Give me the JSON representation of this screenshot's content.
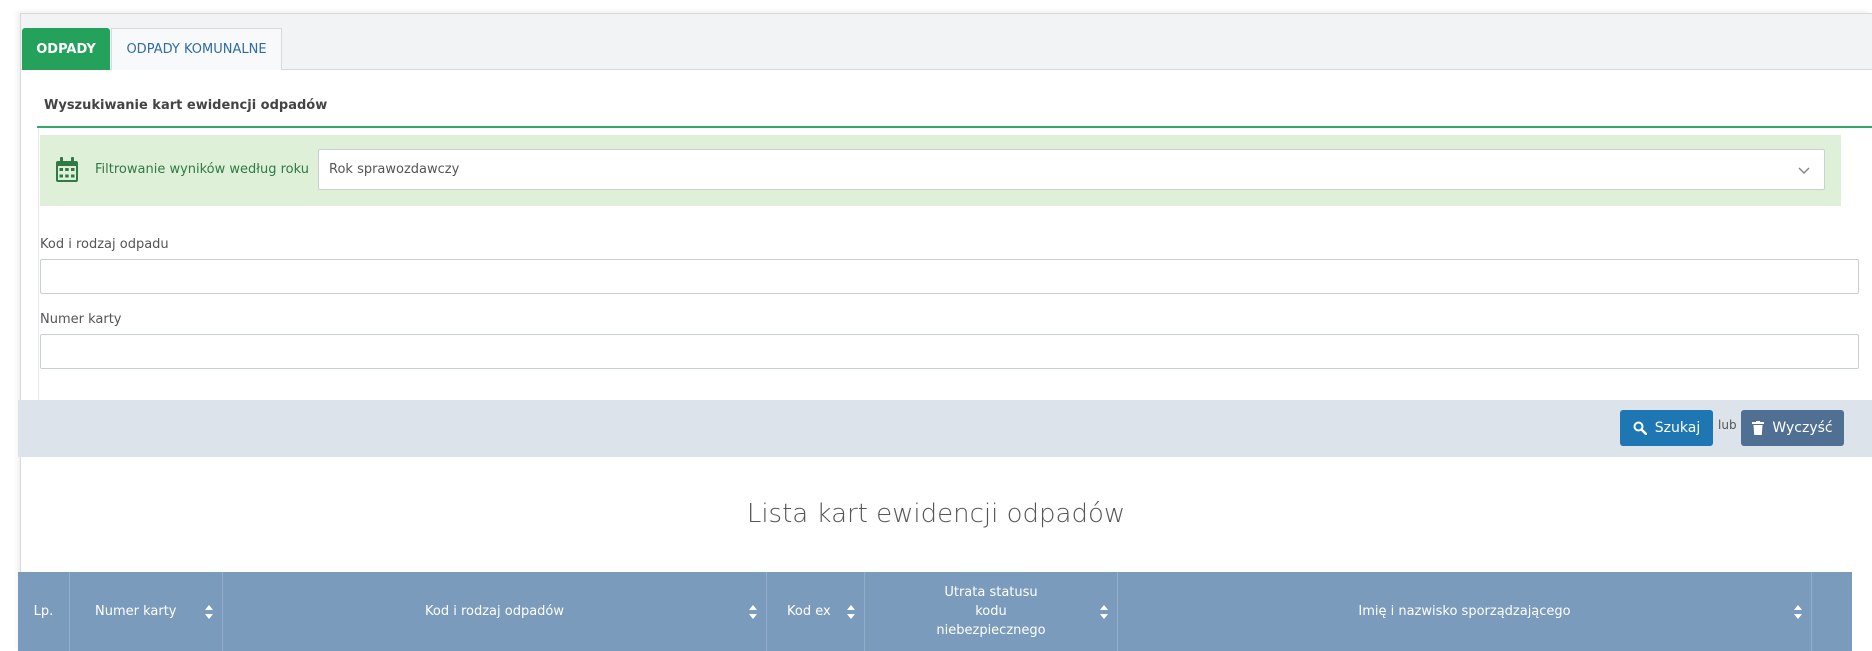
{
  "tabs": [
    {
      "label": "ODPADY",
      "active": true
    },
    {
      "label": "ODPADY KOMUNALNE",
      "active": false
    }
  ],
  "search_section": {
    "title": "Wyszukiwanie kart ewidencji odpadów",
    "year_filter": {
      "icon": "calendar-icon",
      "label": "Filtrowanie wyników według roku",
      "select_placeholder": "Rok sprawozdawczy"
    },
    "waste_code_label": "Kod i rodzaj odpadu",
    "waste_code_value": "",
    "card_number_label": "Numer karty",
    "card_number_value": ""
  },
  "actions": {
    "search_label": "Szukaj",
    "or_label": "lub",
    "clear_label": "Wyczyść"
  },
  "list": {
    "title": "Lista kart ewidencji odpadów",
    "columns": [
      {
        "label": "Lp.",
        "sortable": false
      },
      {
        "label": "Numer karty",
        "sortable": true
      },
      {
        "label": "Kod i rodzaj odpadów",
        "sortable": true
      },
      {
        "label": "Kod ex",
        "sortable": true
      },
      {
        "label": "Utrata statusu kodu niebezpiecznego",
        "sortable": true
      },
      {
        "label": "Imię i nazwisko sporządzającego",
        "sortable": true
      },
      {
        "label": "",
        "sortable": false
      }
    ]
  },
  "colors": {
    "active_tab": "#24a15b",
    "filter_background": "#dff0d8",
    "search_button": "#1e76b3",
    "clear_button": "#4f6f93",
    "table_header": "#7b9bbd"
  }
}
